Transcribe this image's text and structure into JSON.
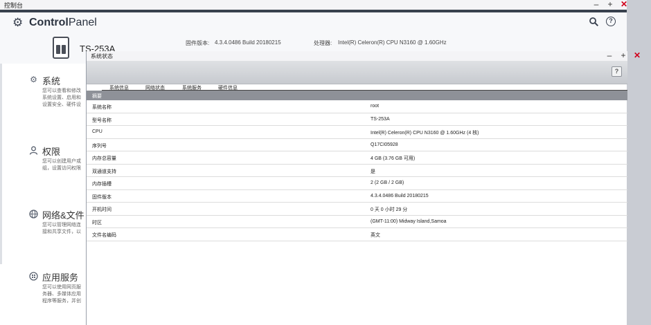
{
  "outer_window": {
    "title": "控制台",
    "controls": {
      "minimize": "–",
      "maximize": "+",
      "close": "✕"
    }
  },
  "control_panel": {
    "title_bold": "Control",
    "title_rest": "Panel",
    "search_icon": "search-icon",
    "help_icon": "?"
  },
  "device": {
    "name": "TS-253A",
    "firmware_label": "固件版本:",
    "firmware_value": "4.3.4.0486 Build 20180215",
    "cpu_label": "处理器:",
    "cpu_value": "Intel(R) Celeron(R) CPU N3160 @ 1.60GHz"
  },
  "categories": [
    {
      "icon": "gear-icon",
      "title": "系统",
      "desc": "您可以查看和修改系统设置、启用和设置安全、硬件设置。"
    },
    {
      "icon": "user-icon",
      "title": "权限",
      "desc": "您可以创建用户或组，设置访问权限和配额等。"
    },
    {
      "icon": "globe-icon",
      "title": "网络&文件",
      "desc": "您可以管理网络连接和共享文件，以便在网络上访问。"
    },
    {
      "icon": "apps-icon",
      "title": "应用服务",
      "desc": "您可以使用网页服务器、多媒体应用程序等服务，并创建VPN连接。"
    }
  ],
  "system_status": {
    "title": "系统状态",
    "controls": {
      "minimize": "–",
      "maximize": "+",
      "close": "✕"
    },
    "help": "?",
    "tabs": [
      "系统信息",
      "网络状态",
      "系统服务",
      "硬件信息"
    ],
    "active_tab": 0,
    "summary_header": "摘要",
    "rows": [
      {
        "key": "系统名称",
        "value": "root"
      },
      {
        "key": "型号名称",
        "value": "TS-253A"
      },
      {
        "key": "CPU",
        "value": "Intel(R) Celeron(R) CPU N3160 @ 1.60GHz (4 核)"
      },
      {
        "key": "序列号",
        "value": "Q17CI05928"
      },
      {
        "key": "内存总容量",
        "value": "4 GB (3.76 GB 可用)"
      },
      {
        "key": "双通道支持",
        "value": "是"
      },
      {
        "key": "内存插槽",
        "value": "2 (2 GB / 2 GB)"
      },
      {
        "key": "固件版本",
        "value": "4.3.4.0486 Build 20180215"
      },
      {
        "key": "开机时间",
        "value": "0 天 0 小时 29 分"
      },
      {
        "key": "时区",
        "value": "(GMT-11:00) Midway Island,Samoa"
      },
      {
        "key": "文件名编码",
        "value": "英文"
      }
    ]
  }
}
